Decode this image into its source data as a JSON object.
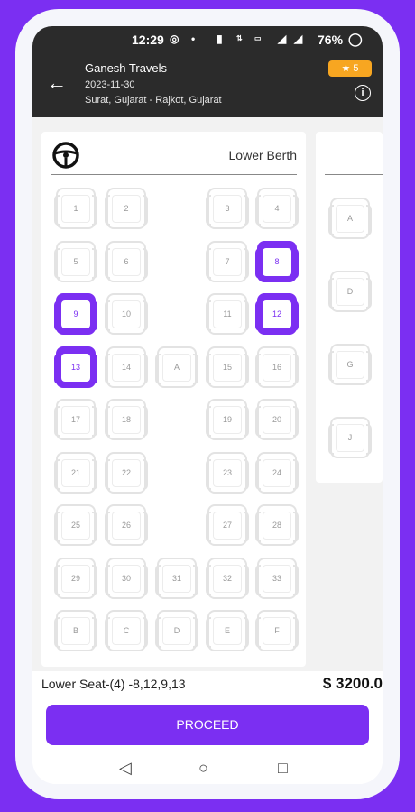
{
  "status": {
    "time": "12:29",
    "battery": "76%",
    "icons": [
      "whatsapp-icon",
      "vibrate-icon",
      "speed-icon",
      "volte-icon",
      "signal-5g-icon",
      "signal-icon",
      "battery-icon"
    ]
  },
  "header": {
    "title": "Ganesh Travels",
    "date": "2023-11-30",
    "route": "Surat, Gujarat - Rajkot, Gujarat",
    "rating": "★ 5"
  },
  "lower_deck": {
    "title": "Lower Berth",
    "rows": [
      [
        "1",
        "2",
        "",
        "3",
        "4"
      ],
      [
        "5",
        "6",
        "",
        "7",
        "8"
      ],
      [
        "9",
        "10",
        "",
        "11",
        "12"
      ],
      [
        "13",
        "14",
        "A",
        "15",
        "16"
      ],
      [
        "17",
        "18",
        "",
        "19",
        "20"
      ],
      [
        "21",
        "22",
        "",
        "23",
        "24"
      ],
      [
        "25",
        "26",
        "",
        "27",
        "28"
      ],
      [
        "29",
        "30",
        "31",
        "32",
        "33"
      ],
      [
        "B",
        "C",
        "D",
        "E",
        "F"
      ]
    ],
    "selected": [
      "8",
      "12",
      "9",
      "13"
    ]
  },
  "upper_deck": {
    "seats": [
      "A",
      "D",
      "G",
      "J"
    ]
  },
  "summary": {
    "text": "Lower Seat-(4) -8,12,9,13",
    "price": "$ 3200.0"
  },
  "action": {
    "proceed": "PROCEED"
  },
  "colors": {
    "accent": "#7b2ff2",
    "header_bg": "#2b2b2b",
    "rating_bg": "#f7a621"
  }
}
